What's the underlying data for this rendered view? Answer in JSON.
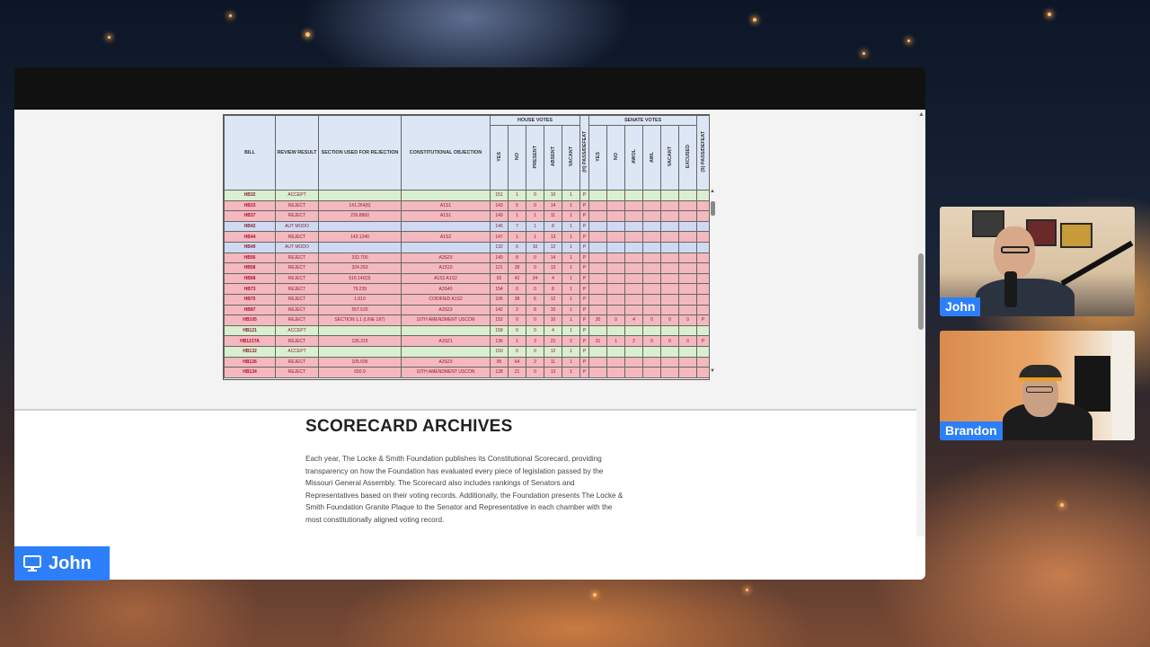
{
  "table": {
    "group_headers": {
      "house": "HOUSE VOTES",
      "senate": "SENATE VOTES"
    },
    "columns": {
      "bill": "BILL",
      "review": "REVIEW RESULT",
      "section": "SECTION USED FOR REJECTION",
      "objection": "CONSTITUTIONAL OBJECTION",
      "h_yes": "YES",
      "h_no": "NO",
      "h_present": "PRESENT",
      "h_absent": "ABSENT",
      "h_vacant": "VACANT",
      "h_pass": "(H) PASS/DEFEAT",
      "s_yes": "YES",
      "s_no": "NO",
      "s_awol": "AWOL",
      "s_awl": "AWL",
      "s_vacant": "VACANT",
      "s_excused": "EXCUSED",
      "s_pass": "(S) PASS/DEFEAT"
    },
    "rows": [
      {
        "status": "accept",
        "c": [
          "HB32",
          "ACCEPT",
          "",
          "",
          "151",
          "1",
          "0",
          "10",
          "1",
          "P",
          "",
          "",
          "",
          "",
          "",
          "",
          ""
        ]
      },
      {
        "status": "reject",
        "c": [
          "HB33",
          "REJECT",
          "141.264(6)",
          "A1S1",
          "143",
          "5",
          "0",
          "14",
          "1",
          "P",
          "",
          "",
          "",
          "",
          "",
          "",
          ""
        ]
      },
      {
        "status": "reject",
        "c": [
          "HB37",
          "REJECT",
          "226.8860",
          "A1S1",
          "149",
          "1",
          "1",
          "11",
          "1",
          "P",
          "",
          "",
          "",
          "",
          "",
          "",
          ""
        ]
      },
      {
        "status": "automodo",
        "c": [
          "HB42",
          "AUT MODO",
          "",
          "",
          "146",
          "7",
          "1",
          "8",
          "1",
          "P",
          "",
          "",
          "",
          "",
          "",
          "",
          ""
        ]
      },
      {
        "status": "reject",
        "c": [
          "HB44",
          "REJECT",
          "143.1240",
          "A1S2",
          "147",
          "1",
          "1",
          "13",
          "1",
          "P",
          "",
          "",
          "",
          "",
          "",
          "",
          ""
        ]
      },
      {
        "status": "automodo",
        "c": [
          "HB49",
          "AUT MODO",
          "",
          "",
          "132",
          "6",
          "10",
          "12",
          "1",
          "P",
          "",
          "",
          "",
          "",
          "",
          "",
          ""
        ]
      },
      {
        "status": "reject",
        "c": [
          "HB56",
          "REJECT",
          "332.700",
          "A3S23",
          "140",
          "8",
          "0",
          "14",
          "1",
          "P",
          "",
          "",
          "",
          "",
          "",
          "",
          ""
        ]
      },
      {
        "status": "reject",
        "c": [
          "HB58",
          "REJECT",
          "324.263",
          "A1S10",
          "121",
          "28",
          "0",
          "13",
          "1",
          "P",
          "",
          "",
          "",
          "",
          "",
          "",
          ""
        ]
      },
      {
        "status": "reject",
        "c": [
          "HB68",
          "REJECT",
          "516.140(3)",
          "A1S1 A1S2",
          "92",
          "42",
          "24",
          "4",
          "1",
          "P",
          "",
          "",
          "",
          "",
          "",
          "",
          ""
        ]
      },
      {
        "status": "reject",
        "c": [
          "HB73",
          "REJECT",
          "79.235",
          "A3S40",
          "154",
          "0",
          "0",
          "8",
          "1",
          "P",
          "",
          "",
          "",
          "",
          "",
          "",
          ""
        ]
      },
      {
        "status": "reject",
        "c": [
          "HB75",
          "REJECT",
          "1.610",
          "CODIFIED A1S2",
          "106",
          "38",
          "6",
          "12",
          "1",
          "P",
          "",
          "",
          "",
          "",
          "",
          "",
          ""
        ]
      },
      {
        "status": "reject",
        "c": [
          "HB87",
          "REJECT",
          "557.520",
          "A3S23",
          "142",
          "2",
          "8",
          "10",
          "1",
          "P",
          "",
          "",
          "",
          "",
          "",
          "",
          ""
        ]
      },
      {
        "status": "reject",
        "c": [
          "HB105",
          "REJECT",
          "SECTION 1.1 (LINE 187)",
          "10TH AMENDMENT USCON",
          "152",
          "0",
          "0",
          "10",
          "1",
          "P",
          "30",
          "0",
          "4",
          "0",
          "0",
          "0",
          "P"
        ]
      },
      {
        "status": "accept",
        "c": [
          "HB121",
          "ACCEPT",
          "",
          "",
          "158",
          "0",
          "0",
          "4",
          "1",
          "P",
          "",
          "",
          "",
          "",
          "",
          "",
          ""
        ]
      },
      {
        "status": "reject",
        "c": [
          "HB121TA",
          "REJECT",
          "135.315",
          "A3S21",
          "136",
          "1",
          "3",
          "21",
          "2",
          "P",
          "31",
          "1",
          "2",
          "0",
          "0",
          "0",
          "P"
        ]
      },
      {
        "status": "accept",
        "c": [
          "HB132",
          "ACCEPT",
          "",
          "",
          "150",
          "0",
          "0",
          "12",
          "1",
          "P",
          "",
          "",
          "",
          "",
          "",
          "",
          ""
        ]
      },
      {
        "status": "reject",
        "c": [
          "HB126",
          "REJECT",
          "105.695",
          "A3S23",
          "95",
          "64",
          "2",
          "11",
          "1",
          "P",
          "",
          "",
          "",
          "",
          "",
          "",
          ""
        ]
      },
      {
        "status": "reject",
        "c": [
          "HB134",
          "REJECT",
          "650.9",
          "10TH AMENDMENT USCON",
          "128",
          "21",
          "0",
          "13",
          "1",
          "P",
          "",
          "",
          "",
          "",
          "",
          "",
          ""
        ]
      }
    ]
  },
  "archives": {
    "title": "SCORECARD ARCHIVES",
    "body": "Each year, The Locke & Smith Foundation publishes its Constitutional Scorecard, providing transparency on how the Foundation has evaluated every piece of legislation passed by the Missouri General Assembly. The Scorecard also includes rankings of Senators and Representatives based on their voting records. Additionally, the Foundation presents The Locke & Smith Foundation Granite Plaque to the Senator and Representative in each chamber with the most constitutionally aligned voting record."
  },
  "presenter": {
    "name": "John",
    "icon": "monitor-icon"
  },
  "participants": [
    {
      "name": "John"
    },
    {
      "name": "Brandon"
    }
  ],
  "colors": {
    "accent_blue": "#2d7ff9",
    "accept_row": "#d9efcf",
    "reject_row": "#f4b8bf",
    "automodo_row": "#cfdaf2"
  }
}
